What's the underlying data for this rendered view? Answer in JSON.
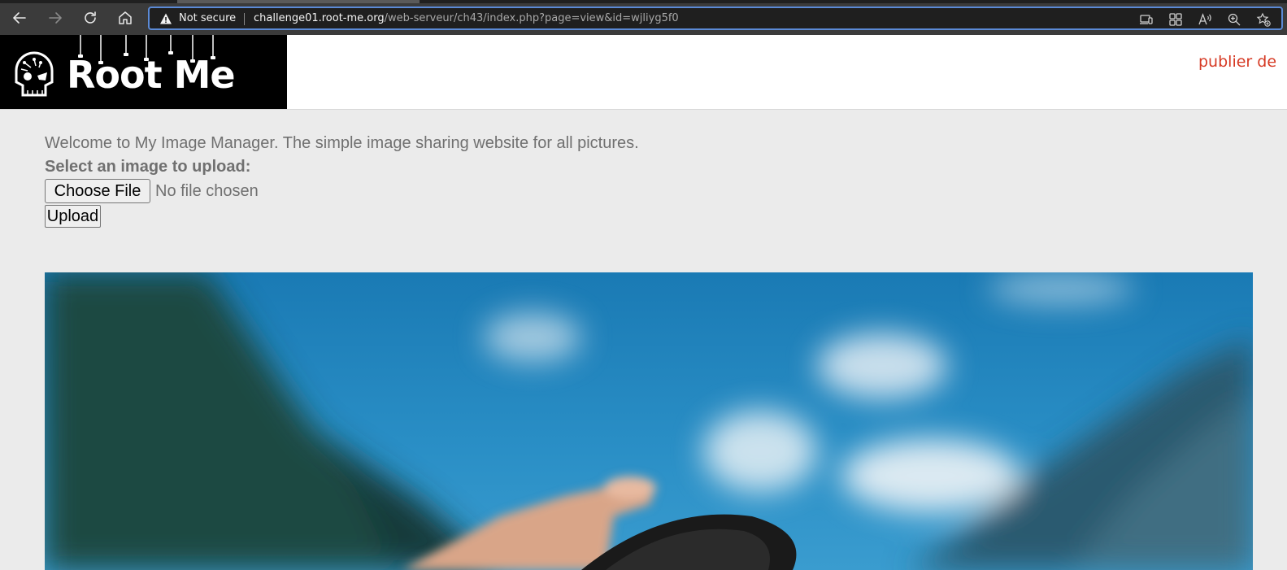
{
  "browser": {
    "security_label": "Not secure",
    "url_host": "challenge01.root-me.org",
    "url_path": "/web-serveur/ch43/index.php?page=view&id=wjliyg5f0",
    "nav_icons": [
      "back-icon",
      "forward-icon",
      "reload-icon",
      "home-icon"
    ],
    "toolbar_icons": [
      "app-available-icon",
      "extensions-grid-icon",
      "read-aloud-icon",
      "zoom-icon",
      "favorites-add-icon"
    ]
  },
  "header": {
    "logo_text": "Root Me",
    "publish_link": "publier de"
  },
  "main": {
    "welcome_text": "Welcome to My Image Manager. The simple image sharing website for all pictures.",
    "select_label": "Select an image to upload:",
    "choose_file_label": "Choose File",
    "no_file_text": "No file chosen",
    "upload_label": "Upload"
  },
  "colors": {
    "accent_red": "#d63a24",
    "address_focus": "#5b8ad6",
    "sky_blue": "#1f7fb8"
  }
}
